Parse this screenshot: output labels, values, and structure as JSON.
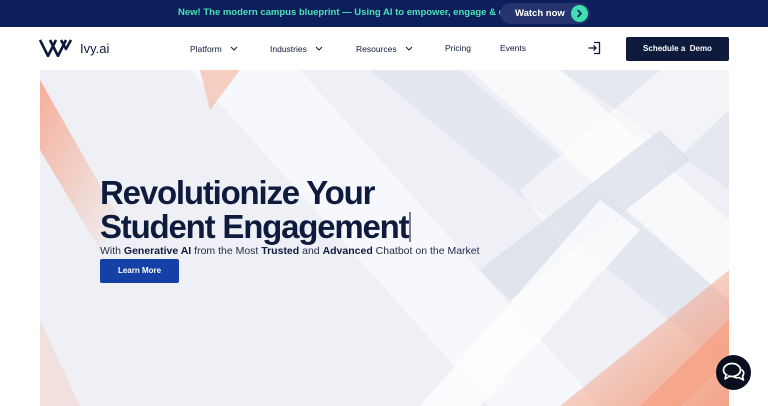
{
  "announcement": {
    "text": "New! The modern campus blueprint — Using AI to empower, engage & enroll",
    "cta_label": "Watch now"
  },
  "brand": {
    "name": "Ivy.ai"
  },
  "nav": {
    "items": [
      {
        "label": "Platform",
        "has_dropdown": true
      },
      {
        "label": "Industries",
        "has_dropdown": true
      },
      {
        "label": "Resources",
        "has_dropdown": true
      },
      {
        "label": "Pricing",
        "has_dropdown": false
      },
      {
        "label": "Events",
        "has_dropdown": false
      }
    ],
    "demo_label": "Schedule a  Demo"
  },
  "hero": {
    "headline_line1": "Revolutionize Your",
    "headline_line2": "Student Engagement",
    "sub_prefix": "With ",
    "sub_bold1": "Generative AI",
    "sub_mid1": " from the Most ",
    "sub_bold2": "Trusted",
    "sub_mid2": " and ",
    "sub_bold3": "Advanced",
    "sub_suffix": " Chatbot on the Market",
    "cta_label": "Learn More"
  },
  "icons": {
    "announcement_arrow": "chevron-right-icon",
    "nav_dropdown": "chevron-down-icon",
    "login": "login-icon",
    "chat": "chat-bubbles-icon"
  },
  "colors": {
    "announcement_bg": "#0d1e5c",
    "announcement_text": "#49e3b6",
    "accent_green": "#3ee0b0",
    "navy": "#0f1b3d",
    "primary_blue": "#1541a6",
    "hero_bg": "#eef0f5"
  }
}
